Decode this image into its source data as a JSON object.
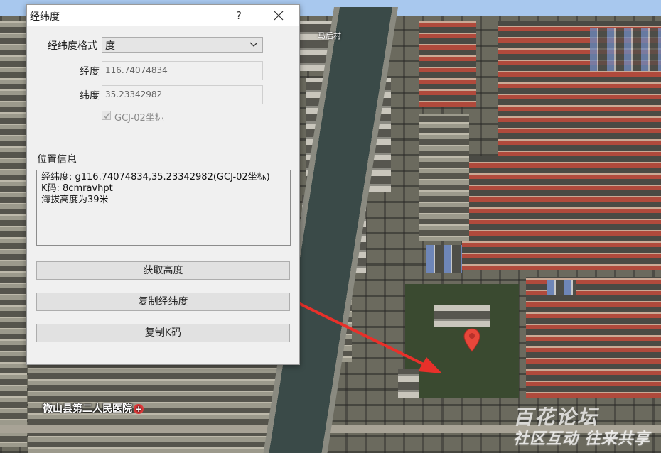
{
  "dialog": {
    "title": "经纬度",
    "help_label": "?",
    "format_label": "经纬度格式",
    "format_value": "度",
    "longitude_label": "经度",
    "longitude_value": "116.74074834",
    "latitude_label": "纬度",
    "latitude_value": "35.23342982",
    "gcj_checkbox_label": "GCJ-02坐标",
    "gcj_checked": true,
    "location_section_label": "位置信息",
    "location_lines": [
      "经纬度: g116.74074834,35.23342982(GCJ-02坐标)",
      "K码: 8cmravhpt",
      "海拔高度为39米"
    ],
    "buttons": {
      "get_height": "获取高度",
      "copy_coords": "复制经纬度",
      "copy_kcode": "复制K码"
    }
  },
  "map": {
    "hospital_label": "微山县第二人民医院",
    "village_label": "马后村",
    "watermark_line1": "百花论坛",
    "watermark_line2": "社区互动 往来共享",
    "pin_color": "#e8473a",
    "arrow_color": "#e8302a"
  }
}
